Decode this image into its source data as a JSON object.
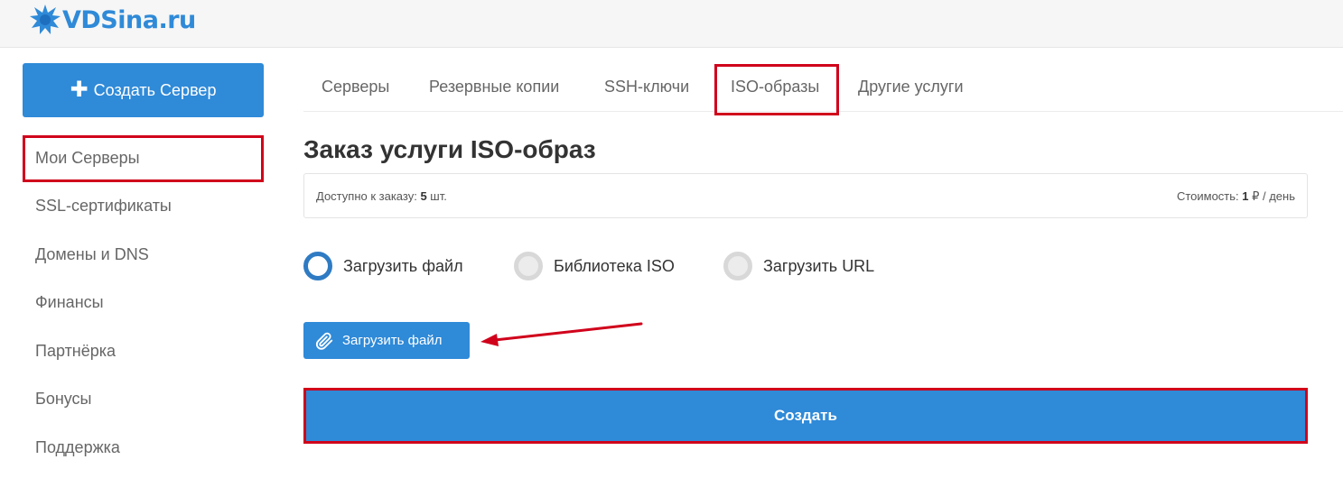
{
  "logo": {
    "text": "VDSina.ru"
  },
  "sidebar": {
    "create_button": {
      "icon": "plus-icon",
      "label": "Создать Сервер"
    },
    "items": [
      {
        "label": "Мои Серверы",
        "highlighted": true
      },
      {
        "label": "SSL-сертификаты"
      },
      {
        "label": "Домены и DNS"
      },
      {
        "label": "Финансы"
      },
      {
        "label": "Партнёрка"
      },
      {
        "label": "Бонусы"
      },
      {
        "label": "Поддержка"
      }
    ]
  },
  "tabs": [
    {
      "label": "Серверы"
    },
    {
      "label": "Резервные копии"
    },
    {
      "label": "SSH-ключи"
    },
    {
      "label": "ISO-образы",
      "active": true,
      "highlighted": true
    },
    {
      "label": "Другие услуги"
    }
  ],
  "main": {
    "title": "Заказ услуги ISO-образ",
    "info": {
      "available_label": "Доступно к заказу: ",
      "available_value": "5",
      "available_unit": " шт.",
      "cost_label": "Стоимость: ",
      "cost_value": "1",
      "cost_unit": " ₽ / день"
    },
    "options": [
      {
        "label": "Загрузить файл",
        "selected": true
      },
      {
        "label": "Библиотека ISO",
        "selected": false
      },
      {
        "label": "Загрузить URL",
        "selected": false
      }
    ],
    "upload_button": {
      "icon": "paperclip-icon",
      "label": "Загрузить файл"
    },
    "create_button": {
      "label": "Создать"
    }
  },
  "colors": {
    "accent": "#2f8ad8",
    "annotation": "#d0021b",
    "radio_selected": "#2f7bc3"
  }
}
